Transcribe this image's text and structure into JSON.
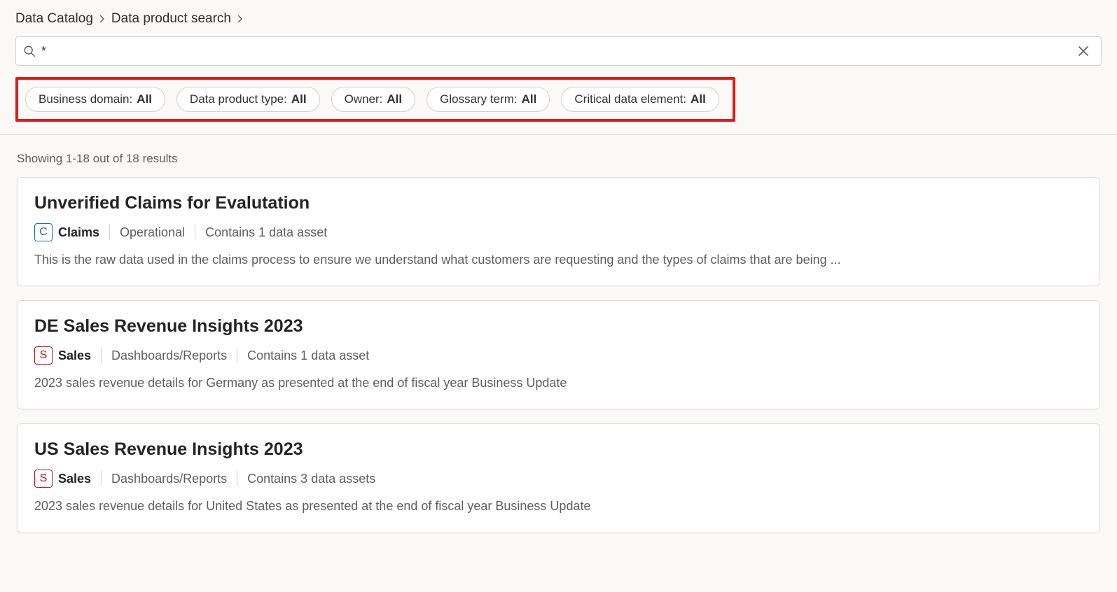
{
  "breadcrumb": {
    "items": [
      "Data Catalog",
      "Data product search"
    ]
  },
  "search": {
    "value": "*"
  },
  "filters": [
    {
      "label": "Business domain:",
      "value": "All"
    },
    {
      "label": "Data product type:",
      "value": "All"
    },
    {
      "label": "Owner:",
      "value": "All"
    },
    {
      "label": "Glossary term:",
      "value": "All"
    },
    {
      "label": "Critical data element:",
      "value": "All"
    }
  ],
  "results_summary": "Showing 1-18 out of 18 results",
  "results": [
    {
      "title": "Unverified Claims for Evalutation",
      "badge_letter": "C",
      "badge_color": "blue",
      "domain": "Claims",
      "type": "Operational",
      "assets": "Contains 1 data asset",
      "description": "This is the raw data used in the claims process to ensure we understand what customers are requesting and the types of claims that are being ..."
    },
    {
      "title": "DE Sales Revenue Insights 2023",
      "badge_letter": "S",
      "badge_color": "red",
      "domain": "Sales",
      "type": "Dashboards/Reports",
      "assets": "Contains 1 data asset",
      "description": "2023 sales revenue details for Germany as presented at the end of fiscal year Business Update"
    },
    {
      "title": "US Sales Revenue Insights 2023",
      "badge_letter": "S",
      "badge_color": "red",
      "domain": "Sales",
      "type": "Dashboards/Reports",
      "assets": "Contains 3 data assets",
      "description": "2023 sales revenue details for United States as presented at the end of fiscal year Business Update"
    }
  ]
}
